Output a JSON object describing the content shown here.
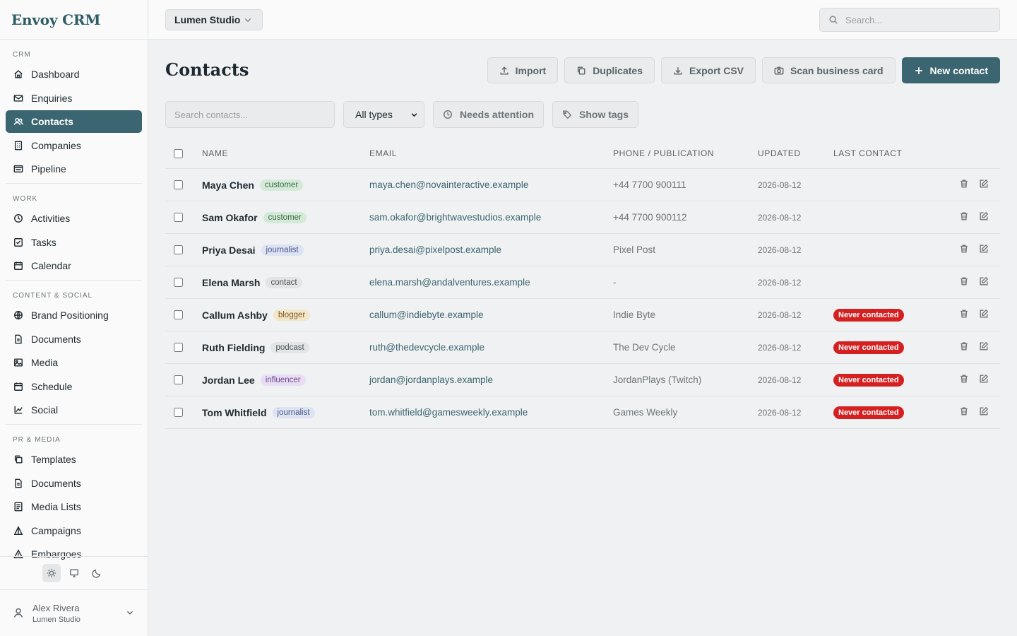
{
  "app": {
    "brand": "Envoy CRM"
  },
  "topbar": {
    "org": "Lumen Studio",
    "search_placeholder": "Search..."
  },
  "sidebar": {
    "sections": [
      {
        "label": "CRM",
        "items": [
          {
            "label": "Dashboard",
            "icon": "home-icon"
          },
          {
            "label": "Enquiries",
            "icon": "mail-icon"
          },
          {
            "label": "Contacts",
            "icon": "users-icon",
            "active": true
          },
          {
            "label": "Companies",
            "icon": "building-icon"
          },
          {
            "label": "Pipeline",
            "icon": "pipeline-icon"
          }
        ]
      },
      {
        "label": "WORK",
        "items": [
          {
            "label": "Activities",
            "icon": "clock-icon"
          },
          {
            "label": "Tasks",
            "icon": "check-square-icon"
          },
          {
            "label": "Calendar",
            "icon": "calendar-icon"
          }
        ]
      },
      {
        "label": "CONTENT & SOCIAL",
        "items": [
          {
            "label": "Brand Positioning",
            "icon": "globe-icon"
          },
          {
            "label": "Documents",
            "icon": "file-icon"
          },
          {
            "label": "Media",
            "icon": "image-icon"
          },
          {
            "label": "Schedule",
            "icon": "calendar-icon"
          },
          {
            "label": "Social",
            "icon": "chart-icon"
          }
        ]
      },
      {
        "label": "PR & MEDIA",
        "items": [
          {
            "label": "Templates",
            "icon": "copy-icon"
          },
          {
            "label": "Documents",
            "icon": "file-icon"
          },
          {
            "label": "Media Lists",
            "icon": "list-icon"
          },
          {
            "label": "Campaigns",
            "icon": "campaign-icon"
          },
          {
            "label": "Embargoes",
            "icon": "alert-icon"
          }
        ]
      }
    ]
  },
  "user": {
    "name": "Alex Rivera",
    "org": "Lumen Studio"
  },
  "page": {
    "title": "Contacts",
    "actions": {
      "import": "Import",
      "duplicates": "Duplicates",
      "export": "Export CSV",
      "scan": "Scan business card",
      "new": "New contact"
    },
    "filters": {
      "search_placeholder": "Search contacts...",
      "type_selected": "All types",
      "needs_attention": "Needs attention",
      "show_tags": "Show tags"
    }
  },
  "table": {
    "columns": {
      "name": "NAME",
      "email": "EMAIL",
      "phone": "PHONE / PUBLICATION",
      "updated": "UPDATED",
      "last": "LAST CONTACT"
    },
    "rows": [
      {
        "name": "Maya Chen",
        "tag": "customer",
        "email": "maya.chen@novainteractive.example",
        "phone": "+44 7700 900111",
        "updated": "2026-08-12",
        "last": ""
      },
      {
        "name": "Sam Okafor",
        "tag": "customer",
        "email": "sam.okafor@brightwavestudios.example",
        "phone": "+44 7700 900112",
        "updated": "2026-08-12",
        "last": ""
      },
      {
        "name": "Priya Desai",
        "tag": "journalist",
        "email": "priya.desai@pixelpost.example",
        "phone": "Pixel Post",
        "updated": "2026-08-12",
        "last": ""
      },
      {
        "name": "Elena Marsh",
        "tag": "contact",
        "email": "elena.marsh@andalventures.example",
        "phone": "-",
        "updated": "2026-08-12",
        "last": ""
      },
      {
        "name": "Callum Ashby",
        "tag": "blogger",
        "email": "callum@indiebyte.example",
        "phone": "Indie Byte",
        "updated": "2026-08-12",
        "last": "Never contacted"
      },
      {
        "name": "Ruth Fielding",
        "tag": "podcast",
        "email": "ruth@thedevcycle.example",
        "phone": "The Dev Cycle",
        "updated": "2026-08-12",
        "last": "Never contacted"
      },
      {
        "name": "Jordan Lee",
        "tag": "influencer",
        "email": "jordan@jordanplays.example",
        "phone": "JordanPlays (Twitch)",
        "updated": "2026-08-12",
        "last": "Never contacted"
      },
      {
        "name": "Tom Whitfield",
        "tag": "journalist",
        "email": "tom.whitfield@gamesweekly.example",
        "phone": "Games Weekly",
        "updated": "2026-08-12",
        "last": "Never contacted"
      }
    ]
  },
  "tag_colors": {
    "customer": {
      "bg": "#d3ead8",
      "fg": "#3d6b48"
    },
    "journalist": {
      "bg": "#dde3f3",
      "fg": "#4a5a8a"
    },
    "contact": {
      "bg": "#e2e4e6",
      "fg": "#4d555a"
    },
    "blogger": {
      "bg": "#f3e6c9",
      "fg": "#7a5a1e"
    },
    "podcast": {
      "bg": "#e2e4e6",
      "fg": "#4d555a"
    },
    "influencer": {
      "bg": "#e8ddf3",
      "fg": "#6a4a8a"
    }
  },
  "colors": {
    "accent": "#3b6570",
    "danger": "#d42020"
  }
}
